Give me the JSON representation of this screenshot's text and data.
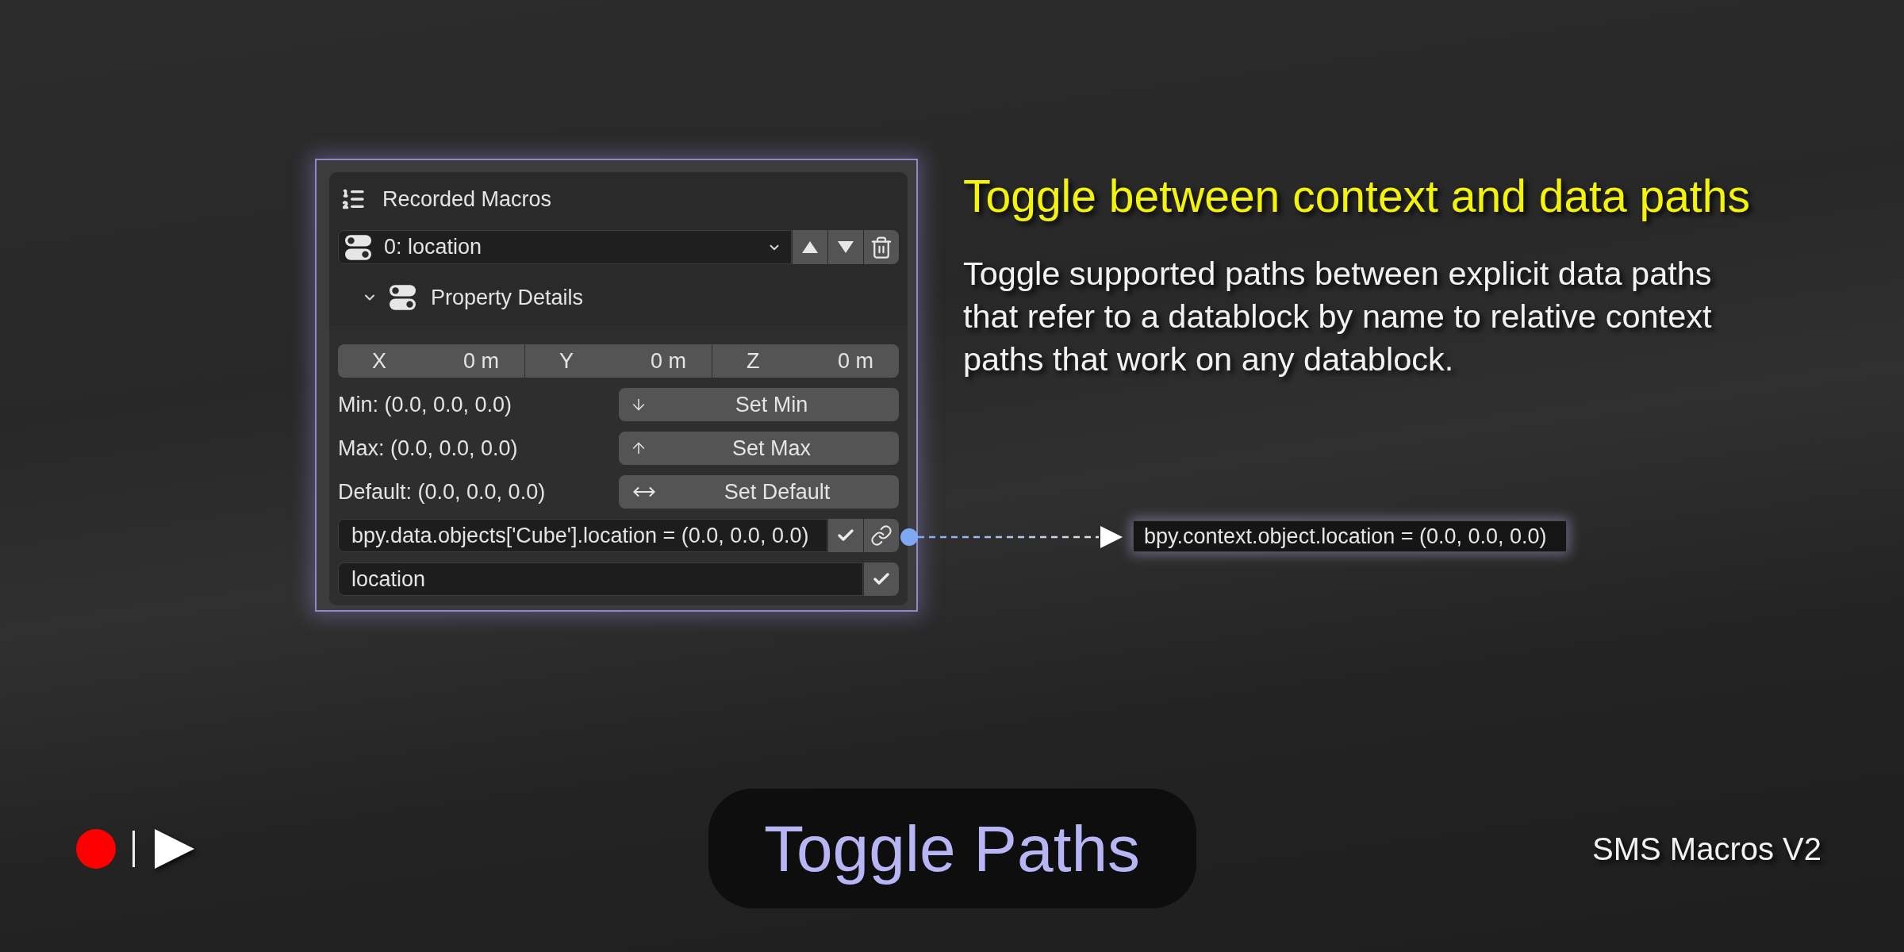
{
  "panel": {
    "header": {
      "title": "Recorded Macros"
    },
    "macro_select": {
      "value": "0: location"
    },
    "property_details": {
      "label": "Property Details",
      "expanded": true
    },
    "vector": [
      {
        "axis": "X",
        "value": "0 m"
      },
      {
        "axis": "Y",
        "value": "0 m"
      },
      {
        "axis": "Z",
        "value": "0 m"
      }
    ],
    "limits": [
      {
        "kind": "down",
        "label": "Min: (0.0, 0.0, 0.0)",
        "button": "Set Min"
      },
      {
        "kind": "up",
        "label": "Max: (0.0, 0.0, 0.0)",
        "button": "Set Max"
      },
      {
        "kind": "both",
        "label": "Default: (0.0, 0.0, 0.0)",
        "button": "Set Default"
      }
    ],
    "path_field": {
      "value": "bpy.data.objects['Cube'].location = (0.0, 0.0, 0.0)"
    },
    "property_field": {
      "value": "location"
    }
  },
  "heading": "Toggle between context and data paths",
  "description": "Toggle supported paths between explicit data paths that refer to a datablock by name to relative context paths that work on any datablock.",
  "callout": {
    "value": "bpy.context.object.location = (0.0, 0.0, 0.0)"
  },
  "footer": {
    "title": "Toggle Paths",
    "brand": "SMS Macros V2"
  }
}
